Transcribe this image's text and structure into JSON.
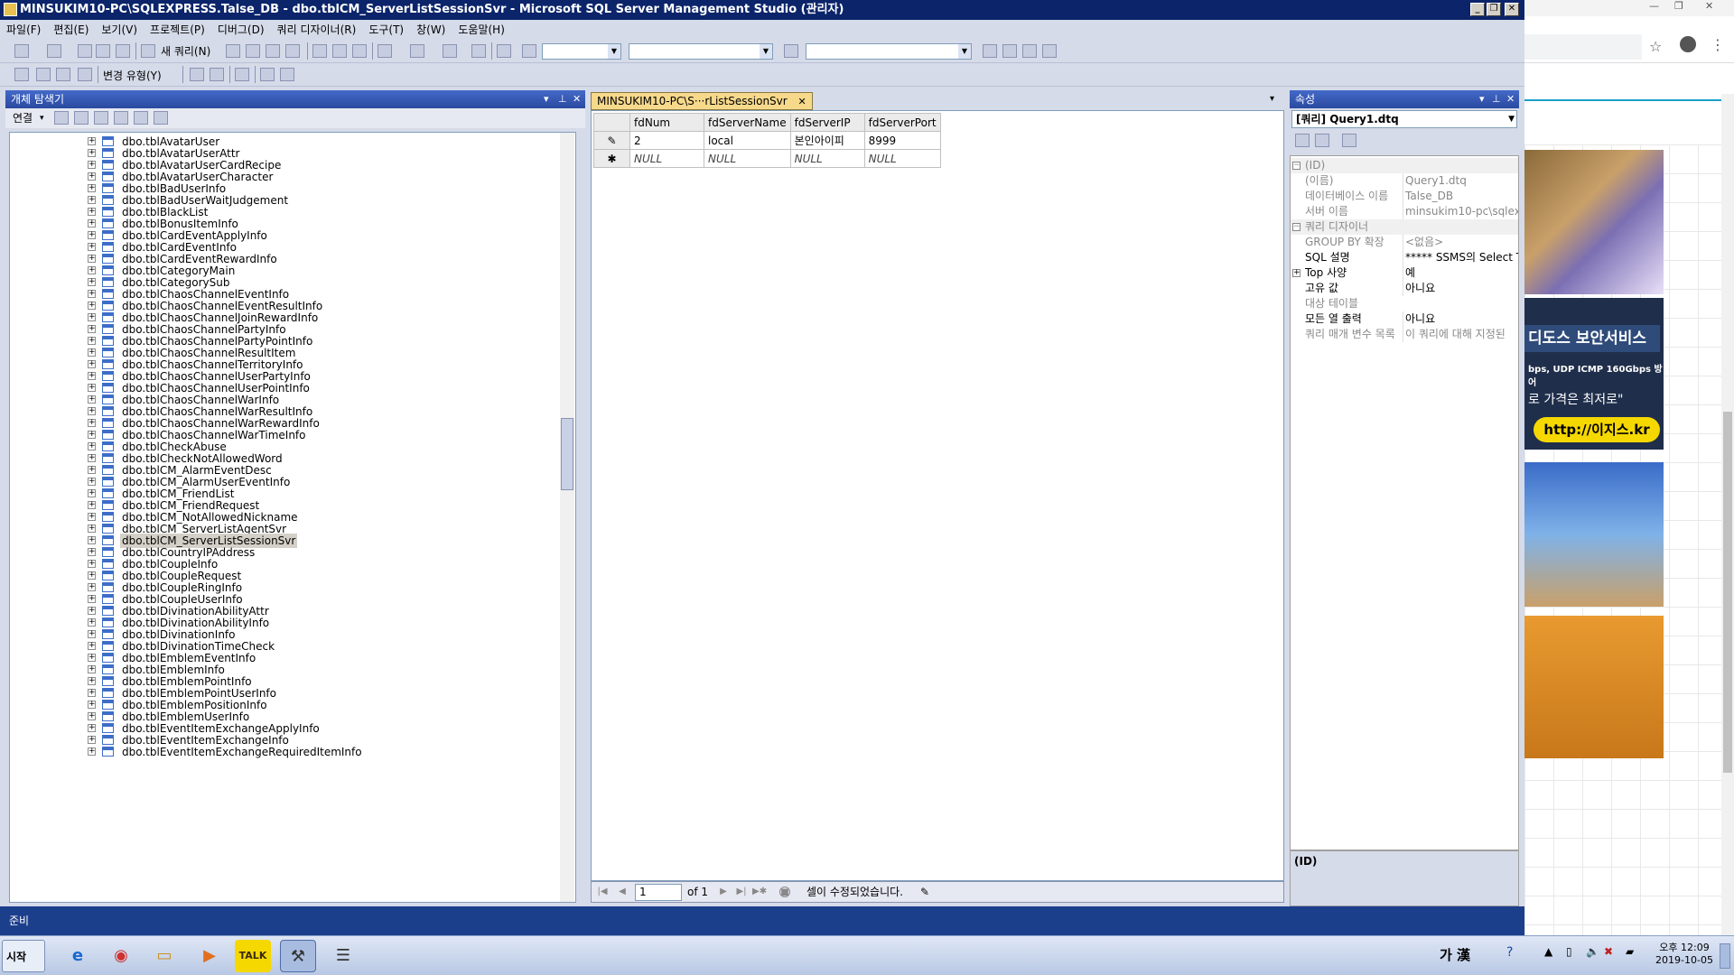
{
  "window": {
    "title": "MINSUKIM10-PC\\SQLEXPRESS.Talse_DB - dbo.tblCM_ServerListSessionSvr - Microsoft SQL Server Management Studio (관리자)"
  },
  "menu": [
    "파일(F)",
    "편집(E)",
    "보기(V)",
    "프로젝트(P)",
    "디버그(D)",
    "쿼리 디자이너(R)",
    "도구(T)",
    "창(W)",
    "도움말(H)"
  ],
  "toolbar": {
    "new_query": "새 쿼리(N)",
    "change_type": "변경 유형(Y)"
  },
  "object_explorer": {
    "title": "개체 탐색기",
    "connect": "연결",
    "selected_index": 35,
    "items": [
      "dbo.tblAvatarUser",
      "dbo.tblAvatarUserAttr",
      "dbo.tblAvatarUserCardRecipe",
      "dbo.tblAvatarUserCharacter",
      "dbo.tblBadUserInfo",
      "dbo.tblBadUserWaitJudgement",
      "dbo.tblBlackList",
      "dbo.tblBonusItemInfo",
      "dbo.tblCardEventApplyInfo",
      "dbo.tblCardEventInfo",
      "dbo.tblCardEventRewardInfo",
      "dbo.tblCategoryMain",
      "dbo.tblCategorySub",
      "dbo.tblChaosChannelEventInfo",
      "dbo.tblChaosChannelEventResultInfo",
      "dbo.tblChaosChannelJoinRewardInfo",
      "dbo.tblChaosChannelPartyInfo",
      "dbo.tblChaosChannelPartyPointInfo",
      "dbo.tblChaosChannelResultItem",
      "dbo.tblChaosChannelTerritoryInfo",
      "dbo.tblChaosChannelUserPartyInfo",
      "dbo.tblChaosChannelUserPointInfo",
      "dbo.tblChaosChannelWarInfo",
      "dbo.tblChaosChannelWarResultInfo",
      "dbo.tblChaosChannelWarRewardInfo",
      "dbo.tblChaosChannelWarTimeInfo",
      "dbo.tblCheckAbuse",
      "dbo.tblCheckNotAllowedWord",
      "dbo.tblCM_AlarmEventDesc",
      "dbo.tblCM_AlarmUserEventInfo",
      "dbo.tblCM_FriendList",
      "dbo.tblCM_FriendRequest",
      "dbo.tblCM_NotAllowedNickname",
      "dbo.tblCM_ServerListAgentSvr",
      "dbo.tblCM_ServerListSessionSvr",
      "dbo.tblCountryIPAddress",
      "dbo.tblCoupleInfo",
      "dbo.tblCoupleRequest",
      "dbo.tblCoupleRingInfo",
      "dbo.tblCoupleUserInfo",
      "dbo.tblDivinationAbilityAttr",
      "dbo.tblDivinationAbilityInfo",
      "dbo.tblDivinationInfo",
      "dbo.tblDivinationTimeCheck",
      "dbo.tblEmblemEventInfo",
      "dbo.tblEmblemInfo",
      "dbo.tblEmblemPointInfo",
      "dbo.tblEmblemPointUserInfo",
      "dbo.tblEmblemPositionInfo",
      "dbo.tblEmblemUserInfo",
      "dbo.tblEventItemExchangeApplyInfo",
      "dbo.tblEventItemExchangeInfo",
      "dbo.tblEventItemExchangeRequiredItemInfo"
    ]
  },
  "document": {
    "tab_label": "MINSUKIM10-PC\\S···rListSessionSvr",
    "columns": [
      "fdNum",
      "fdServerName",
      "fdServerIP",
      "fdServerPort"
    ],
    "rows": [
      {
        "marker": "✎",
        "cells": [
          "2",
          "local",
          "본인아이피",
          "8999"
        ]
      },
      {
        "marker": "✱",
        "cells": [
          "NULL",
          "NULL",
          "NULL",
          "NULL"
        ]
      }
    ],
    "nav_page": "1",
    "nav_of": "of 1",
    "status": "셀이 수정되었습니다."
  },
  "properties": {
    "title": "속성",
    "selected_object": "[쿼리] Query1.dtq",
    "rows": [
      {
        "type": "cat",
        "key": "(ID)"
      },
      {
        "key": "(이름)",
        "value": "Query1.dtq",
        "dim": true
      },
      {
        "key": "데이터베이스 이름",
        "value": "Talse_DB",
        "dim": true
      },
      {
        "key": "서버 이름",
        "value": "minsukim10-pc\\sqlex",
        "dim": true
      },
      {
        "type": "cat",
        "key": "쿼리 디자이너"
      },
      {
        "key": "GROUP BY 확장",
        "value": "<없음>",
        "dim": true
      },
      {
        "key": "SQL 설명",
        "value": "***** SSMS의 Select T"
      },
      {
        "key": "Top 사양",
        "value": "예",
        "expand": true
      },
      {
        "key": "고유 값",
        "value": "아니요"
      },
      {
        "key": "대상 테이블",
        "value": "",
        "dim": true
      },
      {
        "key": "모든 열 출력",
        "value": "아니요"
      },
      {
        "key": "쿼리 매개 변수 목록",
        "value": "이 쿼리에 대해 지정된",
        "dim": true
      }
    ],
    "description_title": "(ID)"
  },
  "status_bar": {
    "text": "준비"
  },
  "browser": {
    "ad1_title": "디도스 보안서비스",
    "ad1_sub": "bps, UDP ICMP 160Gbps 방어",
    "ad1_slogan": "로 가격은 최저로\"",
    "ad1_url": "http://이지스.kr"
  },
  "taskbar": {
    "start": "시작",
    "ime": "가 漢",
    "clock_time": "오후 12:09",
    "clock_date": "2019-10-05"
  }
}
